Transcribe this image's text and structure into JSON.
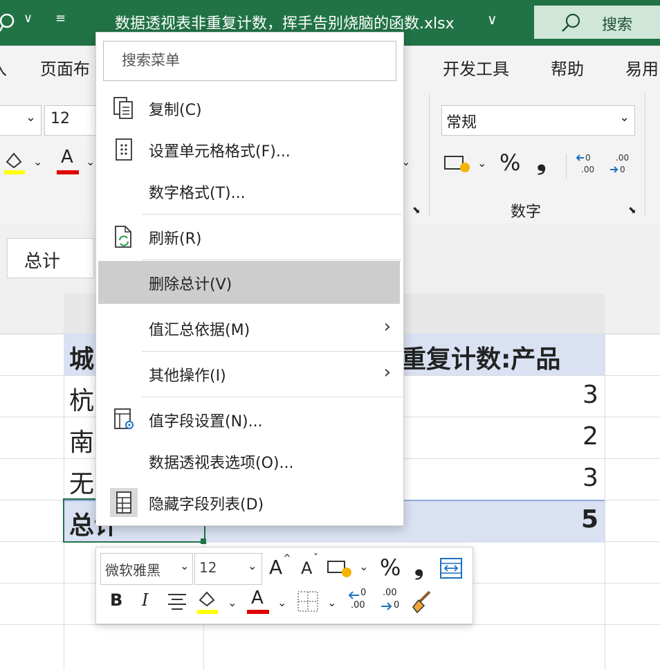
{
  "titlebar": {
    "qat_chevron": "∨",
    "qat_more": "≡",
    "filename": "数据透视表非重复计数，挥手告别烧脑的函数.xlsx",
    "filename_chevron": "∨",
    "search_label": "搜索"
  },
  "ribbon_tabs": {
    "left_partial": "入",
    "page_layout_partial": "页面布",
    "developer": "开发工具",
    "help": "帮助",
    "accessibility_partial": "易用"
  },
  "ribbon": {
    "font_size": "12",
    "number_format": "常规",
    "percent": "%",
    "comma": "❟",
    "number_group": "数字"
  },
  "formula_bar": {
    "name_box_value": "总计"
  },
  "sheet": {
    "col_header_partial": "",
    "header_left_partial": "城",
    "header_right_partial": "重复计数:产品",
    "rows": [
      {
        "city_partial": "杭",
        "count": "3"
      },
      {
        "city_partial": "南",
        "count": "2"
      },
      {
        "city_partial": "无",
        "count": "3"
      }
    ],
    "total_label": "总计",
    "total_value": "5"
  },
  "context_menu": {
    "search_placeholder": "搜索菜单",
    "items": [
      {
        "label": "复制(C)",
        "icon": "copy-icon"
      },
      {
        "label": "设置单元格格式(F)...",
        "icon": "format-cells-icon"
      },
      {
        "label": "数字格式(T)...",
        "icon": ""
      },
      {
        "label": "刷新(R)",
        "icon": "refresh-icon"
      },
      {
        "label": "删除总计(V)",
        "icon": ""
      },
      {
        "label": "值汇总依据(M)",
        "icon": "",
        "submenu": true
      },
      {
        "label": "其他操作(I)",
        "icon": "",
        "submenu": true
      },
      {
        "label": "值字段设置(N)...",
        "icon": "field-settings-icon"
      },
      {
        "label": "数据透视表选项(O)...",
        "icon": ""
      },
      {
        "label": "隐藏字段列表(D)",
        "icon": "field-list-icon"
      }
    ],
    "submenu_arrow": "›"
  },
  "mini_toolbar": {
    "font_name": "微软雅黑",
    "font_size": "12",
    "grow_font": "A",
    "shrink_font": "A",
    "percent": "%",
    "comma": "❟",
    "bold": "B",
    "italic": "I",
    "font_color_letter": "A",
    "increase_decimal": ".00",
    "decrease_decimal": ".0"
  },
  "colors": {
    "excel_green": "#217346",
    "highlight_yellow": "#ffff00",
    "font_red": "#e00000",
    "pivot_header": "#d9e1f2"
  }
}
